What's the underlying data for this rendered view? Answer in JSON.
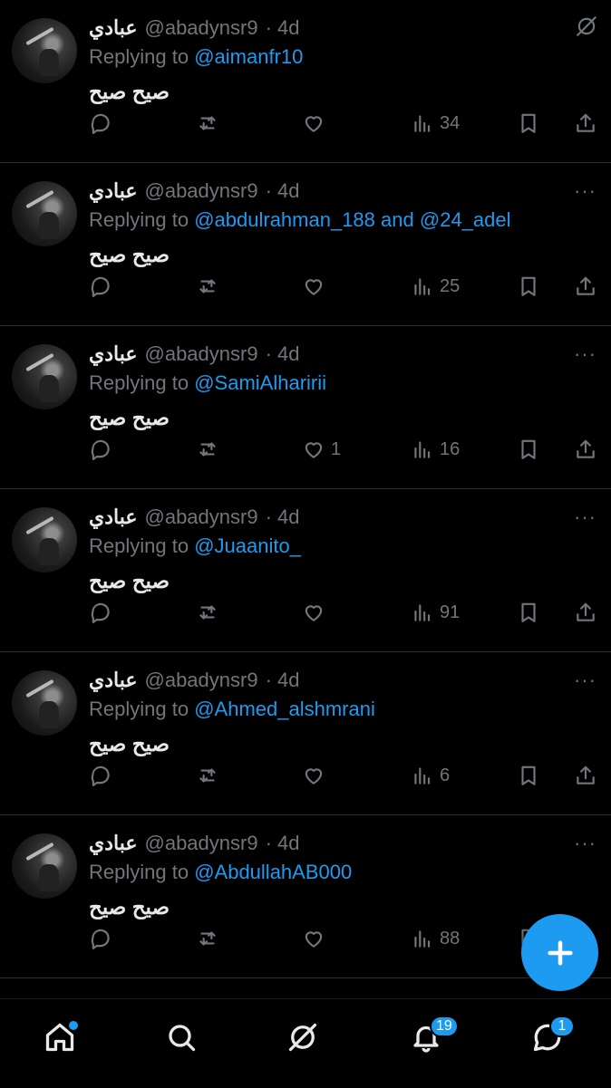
{
  "tweets": [
    {
      "name": "عبادي",
      "handle": "@abadynsr9",
      "time": "· 4d",
      "replying_prefix": "Replying to",
      "mentions": [
        "@aimanfr10"
      ],
      "text": "صيح صيح",
      "likes": "",
      "views": "34",
      "top_icon": "grok-icon"
    },
    {
      "name": "عبادي",
      "handle": "@abadynsr9",
      "time": "· 4d",
      "replying_prefix": "Replying to",
      "mentions": [
        "@abdulrahman_188",
        "@24_adel"
      ],
      "connector": "and",
      "text": "صيح صيح",
      "likes": "",
      "views": "25",
      "top_icon": "more-icon"
    },
    {
      "name": "عبادي",
      "handle": "@abadynsr9",
      "time": "· 4d",
      "replying_prefix": "Replying to",
      "mentions": [
        "@SamiAlharirii"
      ],
      "text": "صيح صيح",
      "likes": "1",
      "views": "16",
      "top_icon": "more-icon"
    },
    {
      "name": "عبادي",
      "handle": "@abadynsr9",
      "time": "· 4d",
      "replying_prefix": "Replying to",
      "mentions": [
        "@Juaanito_"
      ],
      "text": "صيح صيح",
      "likes": "",
      "views": "91",
      "top_icon": "more-icon"
    },
    {
      "name": "عبادي",
      "handle": "@abadynsr9",
      "time": "· 4d",
      "replying_prefix": "Replying to",
      "mentions": [
        "@Ahmed_alshmrani"
      ],
      "text": "صيح صيح",
      "likes": "",
      "views": "6",
      "top_icon": "more-icon"
    },
    {
      "name": "عبادي",
      "handle": "@abadynsr9",
      "time": "· 4d",
      "replying_prefix": "Replying to",
      "mentions": [
        "@AbdullahAB000"
      ],
      "text": "صيح صيح",
      "likes": "",
      "views": "88",
      "top_icon": "more-icon"
    }
  ],
  "more_glyph": "···",
  "nav": {
    "items": [
      {
        "icon": "home-icon",
        "has_dot": true
      },
      {
        "icon": "search-icon"
      },
      {
        "icon": "grok-icon"
      },
      {
        "icon": "bell-icon",
        "badge": "19"
      },
      {
        "icon": "messages-icon",
        "badge": "1"
      }
    ]
  },
  "colors": {
    "accent": "#1d9bf0",
    "muted": "#71767b",
    "text": "#e7e9ea",
    "background": "#000000"
  }
}
